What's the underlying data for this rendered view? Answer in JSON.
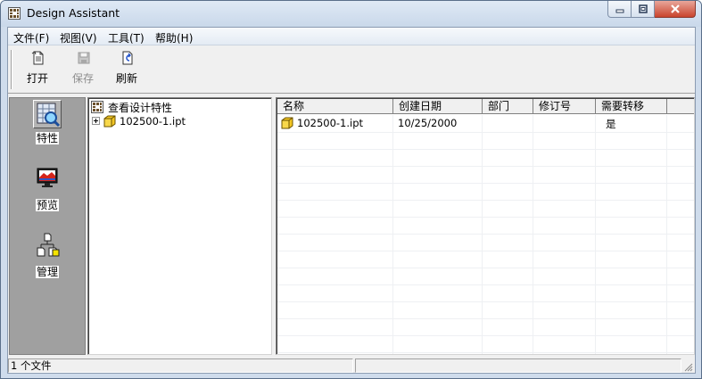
{
  "window": {
    "title": "Design Assistant"
  },
  "menu": [
    "文件(F)",
    "视图(V)",
    "工具(T)",
    "帮助(H)"
  ],
  "toolbar": {
    "open_label": "打开",
    "save_label": "保存",
    "refresh_label": "刷新"
  },
  "nav": {
    "properties_label": "特性",
    "preview_label": "预览",
    "manage_label": "管理"
  },
  "tree": {
    "root_label": "查看设计特性",
    "child_label": "102500-1.ipt"
  },
  "grid": {
    "columns": [
      "名称",
      "创建日期",
      "部门",
      "修订号",
      "需要转移"
    ],
    "rows": [
      {
        "name": "102500-1.ipt",
        "created": "10/25/2000",
        "department": "",
        "revision": "",
        "needs_transfer": "是"
      }
    ]
  },
  "status": {
    "file_count": "1 个文件"
  },
  "colors": {
    "titlebar": "#cfdcec",
    "nav_background": "#a0a0a0",
    "close_button": "#c9442d"
  }
}
